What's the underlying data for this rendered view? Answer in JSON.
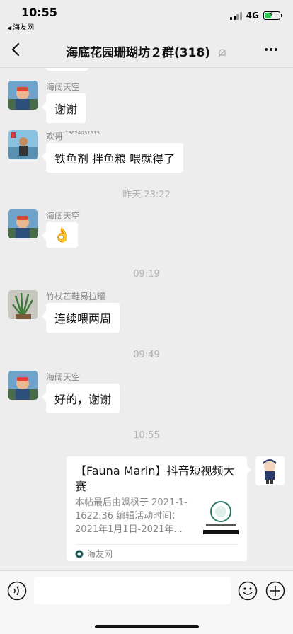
{
  "status_bar": {
    "time": "10:55",
    "back_app": "海友网",
    "network": "4G"
  },
  "nav": {
    "title": "海底花园珊瑚坊２群(318)"
  },
  "messages": [
    {
      "sender": "海阔天空",
      "text": "谢谢"
    },
    {
      "sender": "欢哥",
      "sender_tag": "18624031313",
      "text": "铁鱼剂 拌鱼粮 喂就得了"
    },
    {
      "sender": "海阔天空",
      "emoji": "👌"
    },
    {
      "sender": "竹杖芒鞋易拉罐",
      "text": "连续喂两周"
    },
    {
      "sender": "海阔天空",
      "text": "好的，谢谢"
    }
  ],
  "time_separators": [
    "昨天 23:22",
    "09:19",
    "09:49",
    "10:55"
  ],
  "card": {
    "title": "【Fauna Marin】抖音短视频大赛",
    "description": "本帖最后由飒枫于 2021-1-1622:36 编辑活动时间：2021年1月1日-2021年...",
    "source": "海友网"
  },
  "input_bar": {
    "placeholder": ""
  },
  "colors": {
    "background": "#ededed",
    "bubble": "#ffffff",
    "meta_text": "#888888",
    "battery": "#34c759"
  },
  "icons": [
    "back-chevron-icon",
    "mute-bell-icon",
    "more-dots-icon",
    "voice-icon",
    "emoji-icon",
    "plus-icon",
    "haiyou-logo-icon"
  ]
}
